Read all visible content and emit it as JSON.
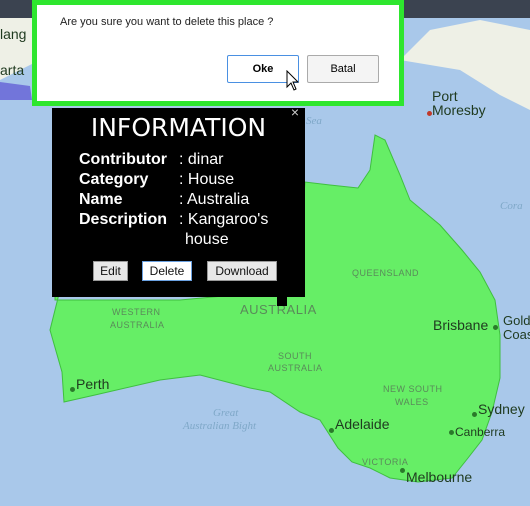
{
  "dialog": {
    "message": "Are you sure you want to delete this place ?",
    "ok_label": "Oke",
    "cancel_label": "Batal"
  },
  "popup": {
    "title": "INFORMATION",
    "close_label": "×",
    "fields": [
      {
        "key": "Contributor",
        "value": ": dinar"
      },
      {
        "key": "Category",
        "value": ": House"
      },
      {
        "key": "Name",
        "value": ": Australia"
      },
      {
        "key": "Description",
        "value": ": Kangaroo's"
      },
      {
        "key": "",
        "value": "house"
      }
    ],
    "buttons": {
      "edit": "Edit",
      "delete": "Delete",
      "download": "Download"
    }
  },
  "map": {
    "cities": [
      "Perth",
      "Adelaide",
      "Melbourne",
      "Sydney",
      "Canberra",
      "Brisbane",
      "Gold",
      "Coas",
      "Port",
      "Moresby",
      "lang",
      "arta"
    ],
    "regions": [
      "WESTERN",
      "AUSTRALIA",
      "AUSTRALIA",
      "SOUTH",
      "AUSTRALIA",
      "QUEENSLAND",
      "NEW SOUTH",
      "WALES",
      "VICTORIA"
    ],
    "seas": [
      "Great",
      "Australian Bight",
      "Cora",
      "Sea"
    ],
    "colors": {
      "ocean": "#a9c8ea",
      "land": "#f3f0e4",
      "highlight": "#66ee66",
      "dialog_border": "#2ee62e"
    }
  }
}
